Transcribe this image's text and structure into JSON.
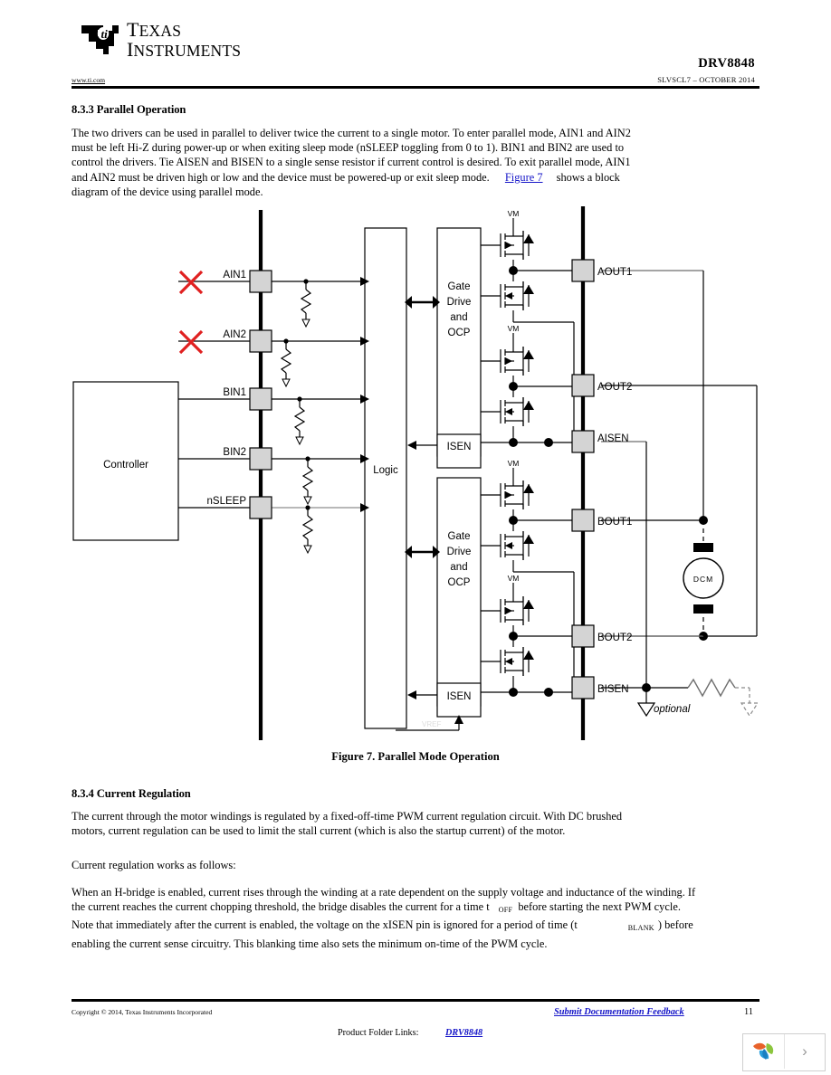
{
  "header": {
    "logo_alt": "Texas Instruments",
    "brand_line1": "Texas",
    "brand_line2": "Instruments",
    "url": "www.ti.com",
    "part_number": "DRV8848",
    "doc_id": "SLVSCL7 – OCTOBER 2014"
  },
  "sections": [
    {
      "number_title": "8.3.3 Parallel Operation",
      "paragraph_pre": "The two drivers can be used in parallel to deliver twice the current to a single motor. To enter parallel mode, AIN1 and AIN2 must be left Hi-Z during power-up or when exiting sleep mode (nSLEEP toggling from 0 to 1). BIN1 and BIN2 are used to control the drivers. Tie AISEN and BISEN to a single sense resistor if current control is desired. To exit parallel mode, AIN1 and AIN2 must be driven high or low and the device must be powered-up or exit sleep mode.",
      "link_text": "Figure 7",
      "paragraph_post": "shows a block diagram of the device using parallel mode."
    },
    {
      "number_title": "8.3.4 Current Regulation",
      "p1": "The current through the motor windings is regulated by a fixed-off-time PWM current regulation circuit. With DC brushed motors, current regulation can be used to limit the stall current (which is also the startup current) of the motor.",
      "p2": "Current regulation works as follows:",
      "p3_a": "When an H-bridge is enabled, current rises through the winding at a rate dependent on the supply voltage and inductance of the winding. If the current reaches the current chopping threshold, the bridge disables the current for a time t",
      "p3_sub1": "OFF",
      "p3_b": "before starting the next PWM cycle. Note that immediately after the current is enabled, the voltage on the xISEN pin is ignored for a period of time (t",
      "p3_sub2": "BLANK",
      "p3_c": ") before enabling the current sense circuitry. This blanking time also sets the minimum on-time of the PWM cycle."
    }
  ],
  "figure": {
    "caption": "Figure 7. Parallel Mode Operation",
    "controller_label": "Controller",
    "logic_label": "Logic",
    "gate_drive_lines": [
      "Gate",
      "Drive",
      "and",
      "OCP"
    ],
    "isen_label": "ISEN",
    "vm_label": "VM",
    "vref_label": "VREF",
    "motor_label": "DCM",
    "optional_label": "optional",
    "input_pins": [
      {
        "label": "AIN1",
        "crossed": true
      },
      {
        "label": "AIN2",
        "crossed": true
      },
      {
        "label": "BIN1",
        "crossed": false
      },
      {
        "label": "BIN2",
        "crossed": false
      },
      {
        "label": "nSLEEP",
        "crossed": false
      }
    ],
    "output_pins": [
      "AOUT1",
      "AOUT2",
      "AISEN",
      "BOUT1",
      "BOUT2",
      "BISEN"
    ],
    "colors": {
      "cross": "#e02020",
      "pin_fill": "#d4d4d4",
      "line": "#000000",
      "faint": "#cfcfcf"
    }
  },
  "footer": {
    "copyright": "Copyright © 2014, Texas Instruments Incorporated",
    "feedback": "Submit Documentation Feedback",
    "page_number": "11",
    "product_folder_label": "Product Folder Links:",
    "product_folder_link": "DRV8848"
  },
  "viewer": {
    "next_glyph": "›"
  }
}
